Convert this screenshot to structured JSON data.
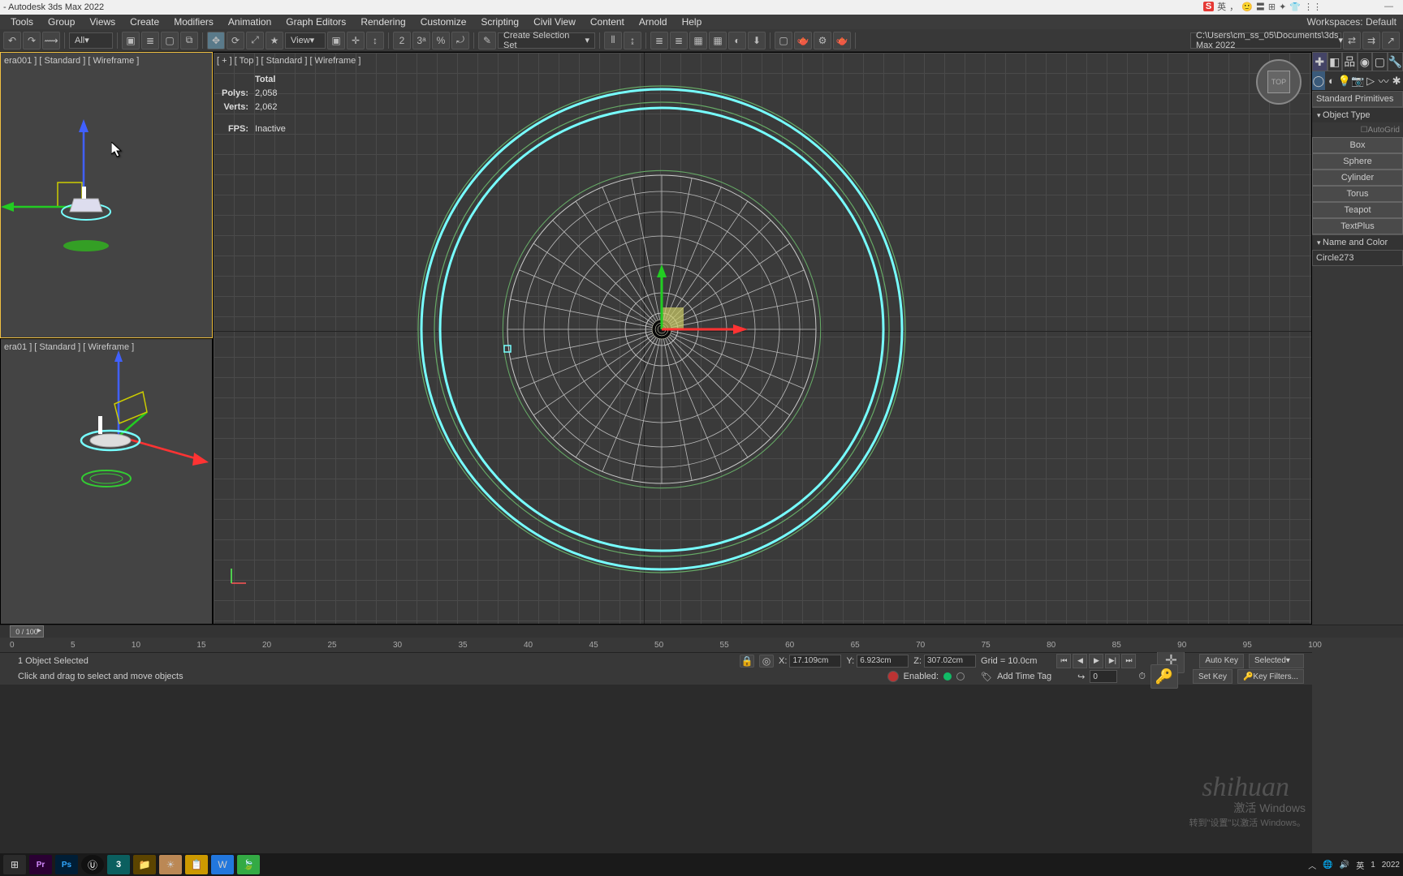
{
  "title": " - Autodesk 3ds Max 2022",
  "ime": {
    "badge": "S",
    "lang": "英",
    "smiley": "☺",
    "icons": [
      "🙂",
      "〓",
      "⊞",
      "✦",
      "👕",
      "⋮⋮"
    ]
  },
  "menu": [
    "Tools",
    "Group",
    "Views",
    "Create",
    "Modifiers",
    "Animation",
    "Graph Editors",
    "Rendering",
    "Customize",
    "Scripting",
    "Civil View",
    "Content",
    "Arnold",
    "Help"
  ],
  "workspaces": {
    "label": "Workspaces:",
    "value": "Default"
  },
  "toolbar": {
    "filterCombo": "All",
    "viewCombo": "View",
    "selSetCombo": "Create Selection Set",
    "path": "C:\\Users\\cm_ss_05\\Documents\\3ds Max 2022",
    "icons": [
      "↺",
      "⦶",
      "⟿",
      "",
      "⧉",
      "↺",
      "⧈",
      "≡",
      " ",
      " ",
      "⬚",
      "⤢",
      "⟳",
      "⧉",
      "★",
      " ",
      "⊕",
      "↔",
      "2",
      "3",
      "%",
      "⤾",
      " ",
      "↨",
      "⟿",
      " ",
      "‖",
      "≣",
      "≣",
      "▦",
      "▦",
      "⬚",
      "⬇",
      " ",
      "⧉",
      "🫖",
      "⚙",
      "🫖",
      " ",
      "⇄",
      "⇄",
      "↗"
    ]
  },
  "viewportLabels": {
    "vp1": "era001 ] [ Standard ] [ Wireframe ]",
    "vp2": "era01 ] [ Standard ] [ Wireframe ]",
    "vp3": "[ + ] [ Top ] [ Standard ] [ Wireframe ]"
  },
  "stats": {
    "totalLabel": "Total",
    "polysLabel": "Polys:",
    "polys": "2,058",
    "vertsLabel": "Verts:",
    "verts": "2,062",
    "fpsLabel": "FPS:",
    "fps": "Inactive"
  },
  "viewcube": "TOP",
  "commandPanel": {
    "dropdownLabel": "Standard Primitives",
    "objectTypeTitle": "Object Type",
    "autogrid": "AutoGrid",
    "buttons": [
      "Box",
      "Sphere",
      "Cylinder",
      "Torus",
      "Teapot",
      "TextPlus"
    ],
    "nameColorTitle": "Name and Color",
    "objectName": "Circle273"
  },
  "timeslider": {
    "thumb": "0 / 100",
    "ticks": [
      "0",
      "5",
      "10",
      "15",
      "20",
      "25",
      "30",
      "35",
      "40",
      "45",
      "50",
      "55",
      "60",
      "65",
      "70",
      "75",
      "80",
      "85",
      "90",
      "95",
      "100"
    ]
  },
  "status": {
    "selection": "1 Object Selected",
    "prompt": "Click and drag to select and move objects",
    "x": "17.109cm",
    "y": "6.923cm",
    "z": "307.02cm",
    "grid": "Grid = 10.0cm",
    "addTimeTag": "Add Time Tag",
    "enabled": "Enabled:",
    "autoKey": "Auto Key",
    "setKey": "Set Key",
    "selected": "Selected",
    "keyFilters": "Key Filters...",
    "frame": "0"
  },
  "activate": {
    "line1": "激活 Windows",
    "line2": "转到\"设置\"以激活 Windows。"
  },
  "watermark": "shihuan",
  "tray": {
    "time": "1",
    "date": "2022",
    "ime": "英"
  }
}
